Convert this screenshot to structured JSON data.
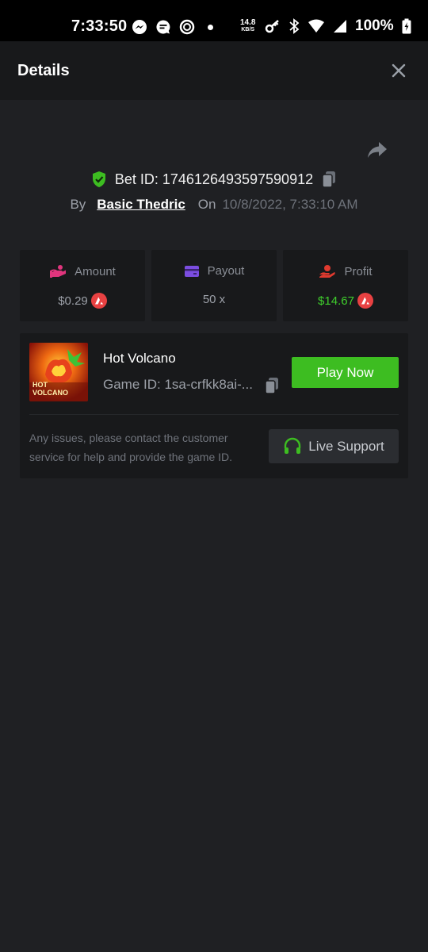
{
  "status_bar": {
    "time": "7:33:50",
    "net_speed": "14.8",
    "net_unit": "KB/S",
    "battery": "100%"
  },
  "header": {
    "title": "Details"
  },
  "bet": {
    "id_label": "Bet ID: 1746126493597590912",
    "by_label": "By",
    "user": "Basic Thedric",
    "on_label": "On",
    "date": "10/8/2022, 7:33:10 AM"
  },
  "stats": {
    "amount": {
      "label": "Amount",
      "value": "$0.29"
    },
    "payout": {
      "label": "Payout",
      "value": "50 x"
    },
    "profit": {
      "label": "Profit",
      "value": "$14.67"
    }
  },
  "game": {
    "name": "Hot Volcano",
    "id_text": "Game ID: 1sa-crfkk8ai-...",
    "thumb_text": "HOT VOLCANO",
    "play_label": "Play Now",
    "help_text": "Any issues, please contact the customer service for help and provide the game ID.",
    "support_label": "Live Support"
  },
  "colors": {
    "accent_green": "#3dbd21",
    "profit_green": "#3fcf2c",
    "coin_red": "#e84142",
    "background": "#1f2023",
    "panel": "#18191b"
  }
}
